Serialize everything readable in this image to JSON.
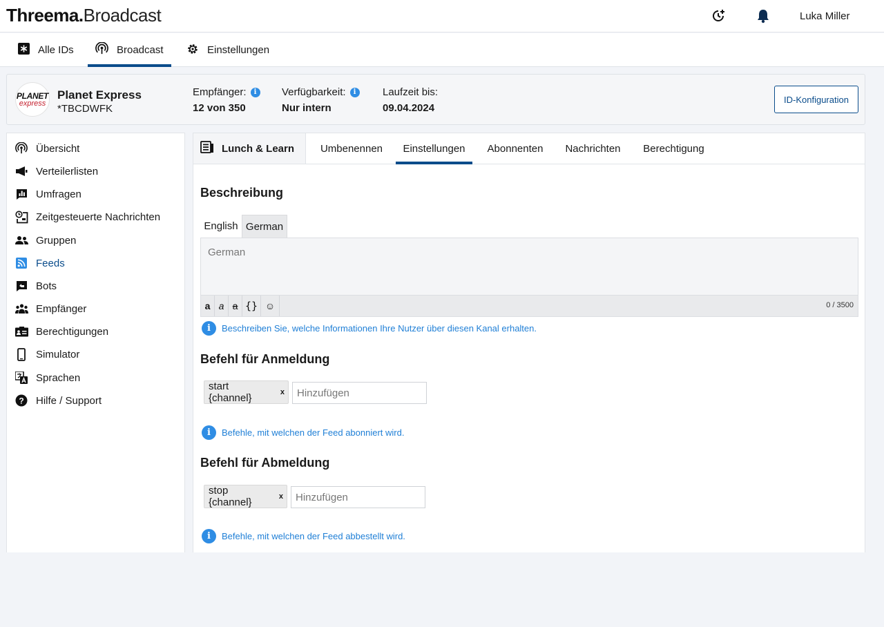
{
  "header": {
    "logo_bold": "Threema.",
    "logo_light": "Broadcast",
    "user_name": "Luka Miller",
    "icons": [
      "history-plus-icon",
      "bell-icon"
    ]
  },
  "nav": {
    "items": [
      {
        "label": "Alle IDs",
        "icon": "asterisk-box-icon"
      },
      {
        "label": "Broadcast",
        "icon": "broadcast-icon",
        "active": true
      },
      {
        "label": "Einstellungen",
        "icon": "gear-icon"
      }
    ]
  },
  "account": {
    "logo_line1": "PLANET",
    "logo_line2": "express",
    "name": "Planet Express",
    "id": "*TBCDWFK",
    "recipients_label": "Empfänger:",
    "recipients_value": "12 von 350",
    "availability_label": "Verfügbarkeit:",
    "availability_value": "Nur intern",
    "runtime_label": "Laufzeit bis:",
    "runtime_value": "09.04.2024",
    "config_button": "ID-Konfiguration"
  },
  "sidebar": {
    "items": [
      {
        "label": "Übersicht",
        "icon": "broadcast-icon"
      },
      {
        "label": "Verteilerlisten",
        "icon": "megaphone-icon"
      },
      {
        "label": "Umfragen",
        "icon": "poll-icon"
      },
      {
        "label": "Zeitgesteuerte Nachrichten",
        "icon": "scheduled-message-icon"
      },
      {
        "label": "Gruppen",
        "icon": "group-icon"
      },
      {
        "label": "Feeds",
        "icon": "rss-icon",
        "active": true
      },
      {
        "label": "Bots",
        "icon": "bot-chat-icon"
      },
      {
        "label": "Empfänger",
        "icon": "recipients-icon"
      },
      {
        "label": "Berechtigungen",
        "icon": "id-card-icon"
      },
      {
        "label": "Simulator",
        "icon": "phone-icon"
      },
      {
        "label": "Sprachen",
        "icon": "translate-icon"
      },
      {
        "label": "Hilfe / Support",
        "icon": "help-icon"
      }
    ]
  },
  "feed": {
    "title": "Lunch & Learn",
    "tabs": [
      "Umbenennen",
      "Einstellungen",
      "Abonnenten",
      "Nachrichten",
      "Berechtigung"
    ],
    "active_tab": "Einstellungen"
  },
  "description": {
    "heading": "Beschreibung",
    "lang_tabs": [
      "English",
      "German"
    ],
    "active_lang": "German",
    "editor_value": "German",
    "toolbar": [
      "a",
      "a",
      "a",
      "{}",
      "☺"
    ],
    "counter": "0 / 3500",
    "hint": "Beschreiben Sie, welche Informationen Ihre Nutzer über diesen Kanal erhalten."
  },
  "subscribe": {
    "heading": "Befehl für Anmeldung",
    "chip": "start {channel}",
    "chip_remove": "x",
    "placeholder": "Hinzufügen",
    "hint": "Befehle, mit welchen der Feed abonniert wird."
  },
  "unsubscribe": {
    "heading": "Befehl für Abmeldung",
    "chip": "stop {channel}",
    "chip_remove": "x",
    "placeholder": "Hinzufügen",
    "hint": "Befehle, mit welchen der Feed abbestellt wird."
  },
  "colors": {
    "accent": "#0a4c8b",
    "info": "#2f8de4",
    "hint_text": "#1f7fd6",
    "background": "#f2f4f8"
  }
}
